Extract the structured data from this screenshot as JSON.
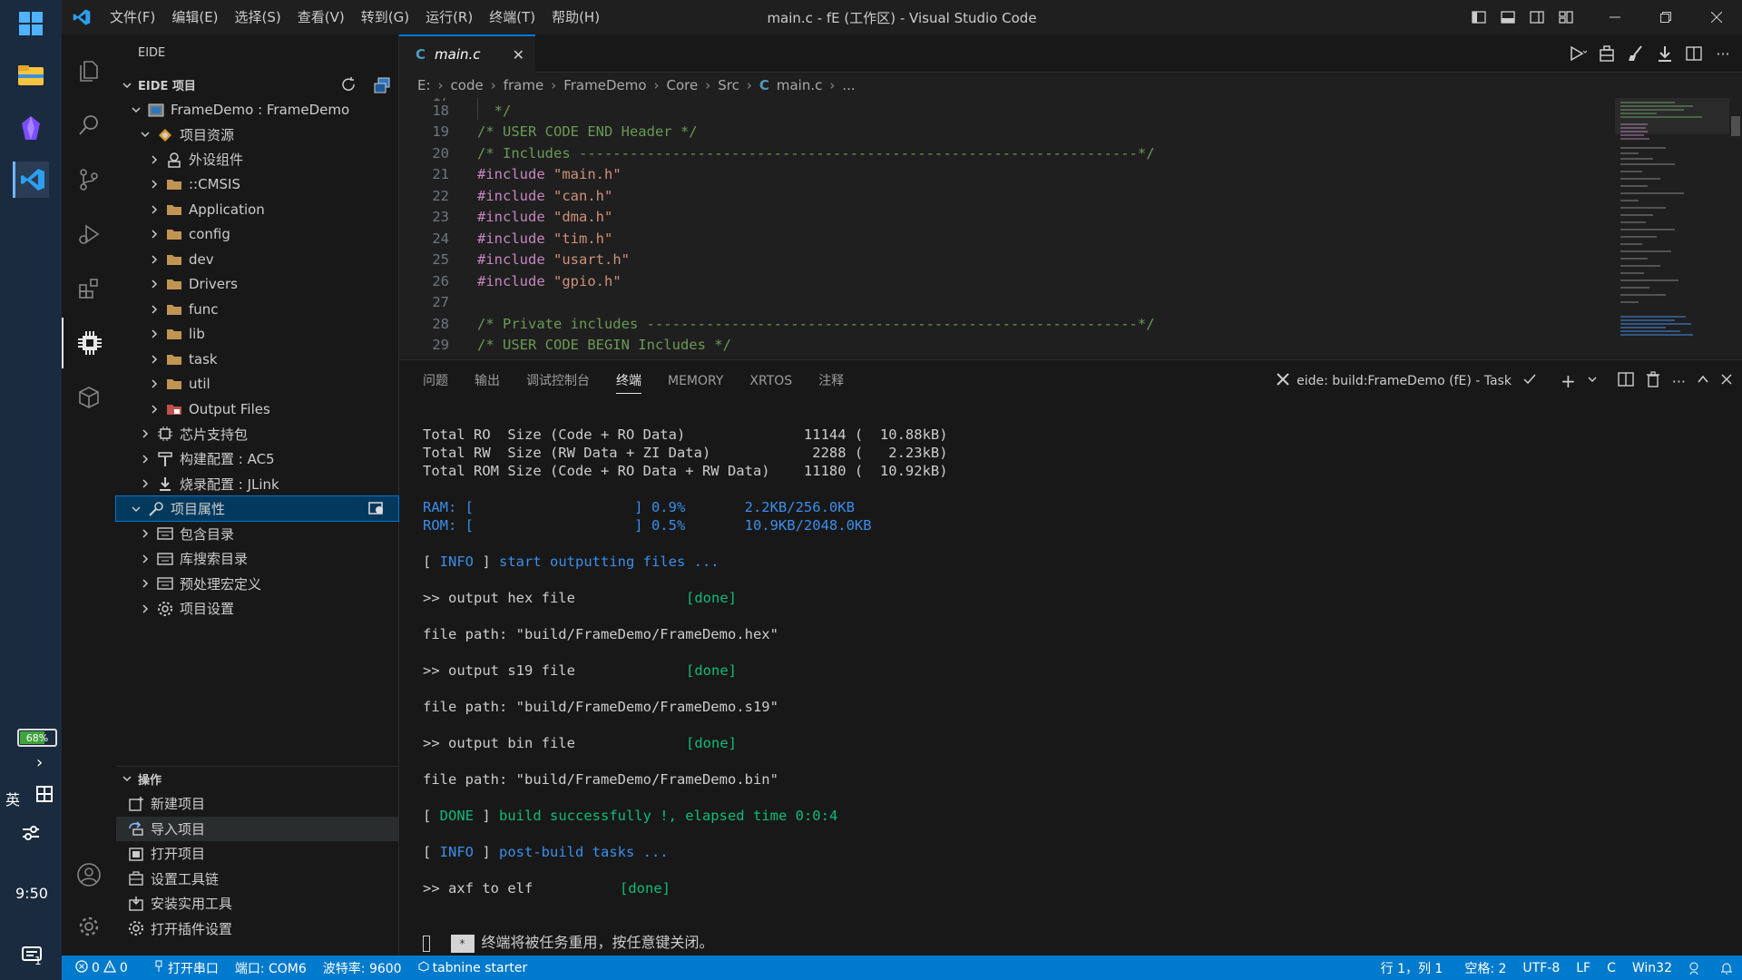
{
  "window": {
    "title": "main.c - fE (工作区) - Visual Studio Code",
    "menu": [
      "文件(F)",
      "编辑(E)",
      "选择(S)",
      "查看(V)",
      "转到(G)",
      "运行(R)",
      "终端(T)",
      "帮助(H)"
    ]
  },
  "taskbar": {
    "battery": "68%",
    "ime_lang": "英",
    "clock": "9:50",
    "notification_count": "1"
  },
  "sidebar": {
    "header": "EIDE",
    "project_section": "EIDE 项目",
    "tree": [
      {
        "label": "FrameDemo : FrameDemo",
        "icon": "project-icon"
      },
      {
        "label": "项目资源",
        "icon": "resources-icon"
      },
      {
        "label": "外设组件",
        "icon": "peripheral-icon"
      },
      {
        "label": "::CMSIS",
        "icon": "folder-icon"
      },
      {
        "label": "Application",
        "icon": "folder-icon"
      },
      {
        "label": "config",
        "icon": "folder-icon"
      },
      {
        "label": "dev",
        "icon": "folder-icon"
      },
      {
        "label": "Drivers",
        "icon": "folder-icon"
      },
      {
        "label": "func",
        "icon": "folder-icon"
      },
      {
        "label": "lib",
        "icon": "folder-icon"
      },
      {
        "label": "task",
        "icon": "folder-icon"
      },
      {
        "label": "util",
        "icon": "folder-icon"
      },
      {
        "label": "Output Files",
        "icon": "output-folder-icon"
      },
      {
        "label": "芯片支持包",
        "icon": "chip-icon"
      },
      {
        "label": "构建配置 : AC5",
        "icon": "build-icon"
      },
      {
        "label": "烧录配置 : JLink",
        "icon": "flash-icon"
      },
      {
        "label": "项目属性",
        "icon": "wrench-icon"
      },
      {
        "label": "包含目录",
        "icon": "list-icon"
      },
      {
        "label": "库搜索目录",
        "icon": "list-icon"
      },
      {
        "label": "预处理宏定义",
        "icon": "list-icon"
      },
      {
        "label": "项目设置",
        "icon": "gear-icon"
      }
    ],
    "operations_section": "操作",
    "operations": [
      "新建项目",
      "导入项目",
      "打开项目",
      "设置工具链",
      "安装实用工具",
      "打开插件设置"
    ]
  },
  "editor": {
    "tab_label": "main.c",
    "tab_lang": "C",
    "breadcrumb": [
      "E:",
      "code",
      "frame",
      "FrameDemo",
      "Core",
      "Src",
      "main.c",
      "..."
    ],
    "lines": [
      {
        "n": "18",
        "text": "  */",
        "cls": "cm"
      },
      {
        "n": "19",
        "text": "/* USER CODE END Header */",
        "cls": "cm"
      },
      {
        "n": "20",
        "text": "/* Includes ------------------------------------------------------------------*/",
        "cls": "cm"
      },
      {
        "n": "21",
        "kw": "#include",
        "str": "\"main.h\""
      },
      {
        "n": "22",
        "kw": "#include",
        "str": "\"can.h\""
      },
      {
        "n": "23",
        "kw": "#include",
        "str": "\"dma.h\""
      },
      {
        "n": "24",
        "kw": "#include",
        "str": "\"tim.h\""
      },
      {
        "n": "25",
        "kw": "#include",
        "str": "\"usart.h\""
      },
      {
        "n": "26",
        "kw": "#include",
        "str": "\"gpio.h\""
      },
      {
        "n": "27",
        "text": "",
        "cls": ""
      },
      {
        "n": "28",
        "text": "/* Private includes ----------------------------------------------------------*/",
        "cls": "cm"
      },
      {
        "n": "29",
        "text": "/* USER CODE BEGIN Includes */",
        "cls": "cm"
      }
    ]
  },
  "panel": {
    "tabs": [
      "问题",
      "输出",
      "调试控制台",
      "终端",
      "MEMORY",
      "XRTOS",
      "注释"
    ],
    "active_tab": "终端",
    "task_label": "eide: build:FrameDemo (fE) - Task"
  },
  "terminal": {
    "size_lines": [
      "Total RO  Size (Code + RO Data)              11144 (  10.88kB)",
      "Total RW  Size (RW Data + ZI Data)            2288 (   2.23kB)",
      "Total ROM Size (Code + RO Data + RW Data)    11180 (  10.92kB)"
    ],
    "ram_line": "RAM: [                   ] 0.9%       2.2KB/256.0KB",
    "rom_line": "ROM: [                   ] 0.5%       10.9KB/2048.0KB",
    "info_tag": "INFO",
    "info1_msg": "start outputting files ...",
    "hex_line": ">> output hex file",
    "done_tag": "[done]",
    "hex_path": "file path: \"build/FrameDemo/FrameDemo.hex\"",
    "s19_line": ">> output s19 file",
    "s19_path": "file path: \"build/FrameDemo/FrameDemo.s19\"",
    "bin_line": ">> output bin file",
    "bin_path": "file path: \"build/FrameDemo/FrameDemo.bin\"",
    "done_label": "DONE",
    "build_msg": "build successfully !, elapsed time 0:0:4",
    "info2_msg": "post-build tasks ...",
    "axf_line": ">> axf to elf",
    "reuse_msg": "终端将被任务重用，按任意键关闭。"
  },
  "statusbar": {
    "errors": "0",
    "warnings": "0",
    "open_serial": "打开串口",
    "port": "端口: COM6",
    "baud": "波特率: 9600",
    "tabnine": "tabnine starter",
    "position": "行 1，列 1",
    "spaces": "空格: 2",
    "encoding": "UTF-8",
    "eol": "LF",
    "language": "C",
    "platform": "Win32"
  },
  "colors": {
    "accent": "#007acc",
    "selection": "#04395e",
    "comment": "#6a9955",
    "keyword": "#c586c0",
    "string": "#ce9178",
    "term_blue": "#3b8eea",
    "term_green": "#0dbc79"
  }
}
